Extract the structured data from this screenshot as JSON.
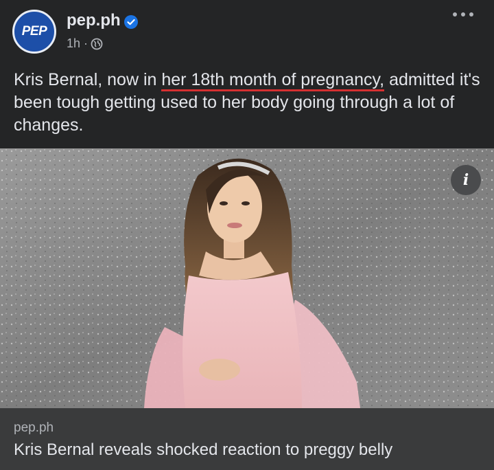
{
  "post": {
    "page_name": "pep.ph",
    "avatar_text": "PEP",
    "timestamp": "1h ·",
    "caption_before": "Kris Bernal, now in ",
    "caption_underlined": "her 18th month of pregnancy,",
    "caption_after": " admitted it's been tough getting used to her body going through a lot of changes."
  },
  "link_preview": {
    "domain": "pep.ph",
    "title": "Kris Bernal reveals shocked reaction to preggy belly"
  },
  "icons": {
    "verified": "verified-badge-icon",
    "privacy": "globe-icon",
    "more": "more-options-icon",
    "info": "info-icon"
  },
  "colors": {
    "background": "#242526",
    "link_preview_bg": "#3a3b3c",
    "annotation_underline": "#d63031",
    "verified_blue": "#1b74e4"
  }
}
